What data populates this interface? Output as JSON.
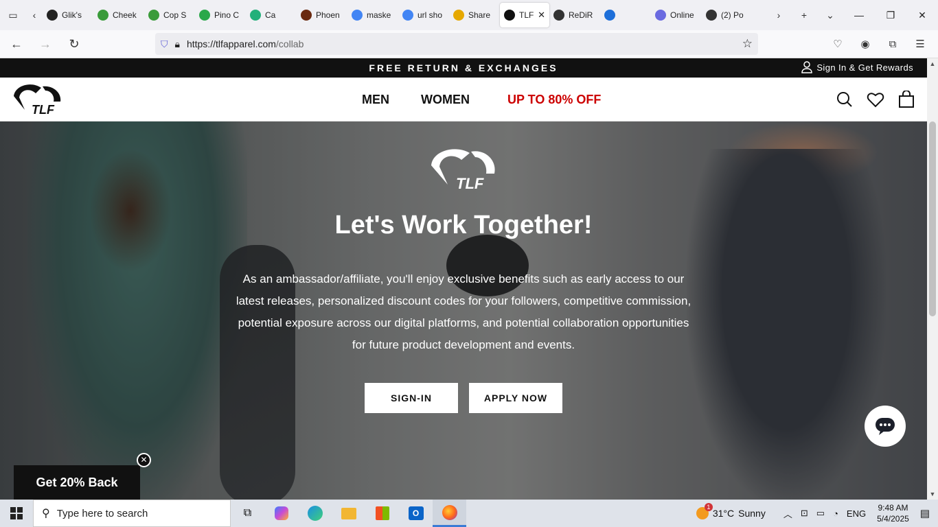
{
  "browser": {
    "tabs": [
      {
        "title": "Glik's",
        "icon": "glik-favicon",
        "color": "#222222"
      },
      {
        "title": "Cheek",
        "icon": "cheek-favicon",
        "color": "#3a9b3a"
      },
      {
        "title": "Cop S",
        "icon": "cop-favicon",
        "color": "#3a9b3a"
      },
      {
        "title": "Pino C",
        "icon": "pino-favicon",
        "color": "#2aa84a"
      },
      {
        "title": "Ca",
        "icon": "ca-favicon",
        "color": "#22b07a"
      },
      {
        "title": "Phoen",
        "icon": "phoen-favicon",
        "color": "#6a2a10"
      },
      {
        "title": "maske",
        "icon": "google-favicon",
        "color": "#4285f4"
      },
      {
        "title": "url sho",
        "icon": "google-favicon",
        "color": "#4285f4"
      },
      {
        "title": "Share",
        "icon": "star-favicon",
        "color": "#e6a800"
      },
      {
        "title": "TLF",
        "icon": "tlf-favicon",
        "color": "#111111",
        "active": true
      },
      {
        "title": "ReDiR",
        "icon": "link-favicon",
        "color": "#333333"
      },
      {
        "title": "",
        "icon": "blue-square-favicon",
        "color": "#1e6fd9"
      },
      {
        "title": "Online",
        "icon": "online-favicon",
        "color": "#6a6ae0"
      },
      {
        "title": "(2) Po",
        "icon": "po-favicon",
        "color": "#333333"
      }
    ],
    "url_host": "https://tlfapparel.com",
    "url_path": "/collab"
  },
  "site": {
    "promo_message": "FREE RETURN & EXCHANGES",
    "sign_in_label": "Sign In & Get Rewards",
    "logo_text": "TLF",
    "nav": {
      "men": "MEN",
      "women": "WOMEN",
      "sale": "UP TO 80% OFF"
    },
    "colors": {
      "sale": "#cc0000"
    },
    "hero": {
      "logo_text": "TLF",
      "title": "Let's Work Together!",
      "body": "As an ambassador/affiliate, you'll enjoy exclusive benefits such as early access to our latest releases, personalized discount codes for your followers, competitive commission, potential exposure across our digital platforms, and potential collaboration opportunities for future product development and events.",
      "signin_btn": "SIGN-IN",
      "apply_btn": "APPLY NOW"
    },
    "get_back": "Get 20% Back"
  },
  "taskbar": {
    "search_placeholder": "Type here to search",
    "weather_temp": "31°C",
    "weather_text": "Sunny",
    "weather_badge": "1",
    "language": "ENG",
    "time": "9:48 AM",
    "date": "5/4/2025"
  }
}
